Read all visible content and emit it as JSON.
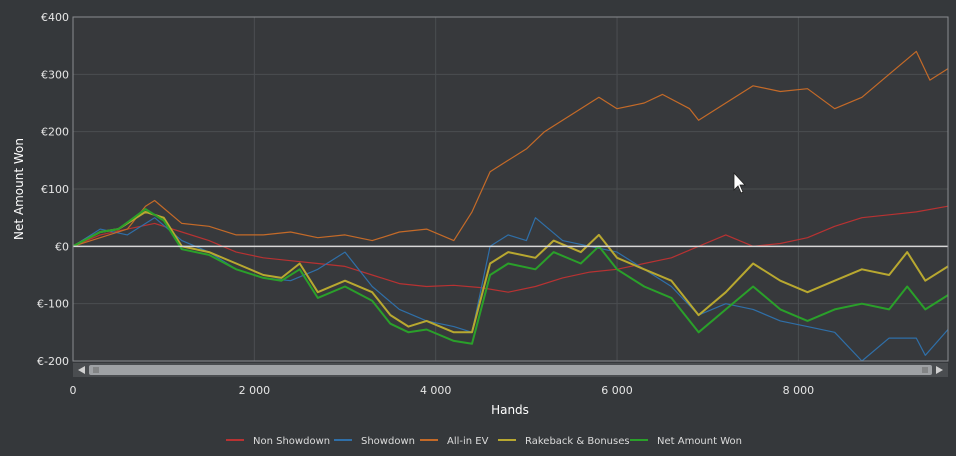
{
  "chart_data": {
    "type": "line",
    "title": "",
    "xlabel": "Hands",
    "ylabel": "Net Amount Won",
    "xlim": [
      0,
      9650
    ],
    "ylim": [
      -200,
      400
    ],
    "x_ticks": [
      0,
      2000,
      4000,
      6000,
      8000
    ],
    "x_tick_labels": [
      "0",
      "2 000",
      "4 000",
      "6 000",
      "8 000"
    ],
    "y_ticks": [
      -200,
      -100,
      0,
      100,
      200,
      300,
      400
    ],
    "y_tick_labels": [
      "€-200",
      "€-100",
      "€0",
      "€100",
      "€200",
      "€300",
      "€400"
    ],
    "grid": true,
    "legend_position": "bottom",
    "series": [
      {
        "name": "Non Showdown",
        "color": "#b83232",
        "points": [
          [
            0,
            0
          ],
          [
            300,
            20
          ],
          [
            600,
            30
          ],
          [
            900,
            40
          ],
          [
            1200,
            25
          ],
          [
            1500,
            10
          ],
          [
            1800,
            -10
          ],
          [
            2100,
            -20
          ],
          [
            2400,
            -25
          ],
          [
            2700,
            -30
          ],
          [
            3000,
            -35
          ],
          [
            3300,
            -50
          ],
          [
            3600,
            -65
          ],
          [
            3900,
            -70
          ],
          [
            4200,
            -68
          ],
          [
            4500,
            -72
          ],
          [
            4800,
            -80
          ],
          [
            5100,
            -70
          ],
          [
            5400,
            -55
          ],
          [
            5700,
            -45
          ],
          [
            6000,
            -40
          ],
          [
            6300,
            -30
          ],
          [
            6600,
            -20
          ],
          [
            6900,
            0
          ],
          [
            7200,
            20
          ],
          [
            7500,
            0
          ],
          [
            7800,
            5
          ],
          [
            8100,
            15
          ],
          [
            8400,
            35
          ],
          [
            8700,
            50
          ],
          [
            9000,
            55
          ],
          [
            9300,
            60
          ],
          [
            9650,
            70
          ]
        ]
      },
      {
        "name": "Showdown",
        "color": "#2f6fa8",
        "points": [
          [
            0,
            0
          ],
          [
            300,
            30
          ],
          [
            600,
            20
          ],
          [
            900,
            50
          ],
          [
            1200,
            10
          ],
          [
            1500,
            -10
          ],
          [
            1800,
            -40
          ],
          [
            2100,
            -55
          ],
          [
            2400,
            -60
          ],
          [
            2700,
            -40
          ],
          [
            3000,
            -10
          ],
          [
            3300,
            -70
          ],
          [
            3600,
            -110
          ],
          [
            3900,
            -130
          ],
          [
            4200,
            -140
          ],
          [
            4400,
            -150
          ],
          [
            4600,
            0
          ],
          [
            4800,
            20
          ],
          [
            5000,
            10
          ],
          [
            5100,
            50
          ],
          [
            5400,
            10
          ],
          [
            5700,
            0
          ],
          [
            6000,
            -10
          ],
          [
            6300,
            -40
          ],
          [
            6600,
            -70
          ],
          [
            6900,
            -120
          ],
          [
            7200,
            -100
          ],
          [
            7500,
            -110
          ],
          [
            7800,
            -130
          ],
          [
            8100,
            -140
          ],
          [
            8400,
            -150
          ],
          [
            8700,
            -200
          ],
          [
            9000,
            -160
          ],
          [
            9300,
            -160
          ],
          [
            9400,
            -190
          ],
          [
            9650,
            -145
          ]
        ]
      },
      {
        "name": "All-in EV",
        "color": "#c46a28",
        "points": [
          [
            0,
            0
          ],
          [
            300,
            15
          ],
          [
            600,
            30
          ],
          [
            800,
            70
          ],
          [
            900,
            80
          ],
          [
            1200,
            40
          ],
          [
            1500,
            35
          ],
          [
            1800,
            20
          ],
          [
            2100,
            20
          ],
          [
            2400,
            25
          ],
          [
            2700,
            15
          ],
          [
            3000,
            20
          ],
          [
            3300,
            10
          ],
          [
            3600,
            25
          ],
          [
            3900,
            30
          ],
          [
            4200,
            10
          ],
          [
            4400,
            60
          ],
          [
            4600,
            130
          ],
          [
            4800,
            150
          ],
          [
            5000,
            170
          ],
          [
            5200,
            200
          ],
          [
            5500,
            230
          ],
          [
            5800,
            260
          ],
          [
            6000,
            240
          ],
          [
            6300,
            250
          ],
          [
            6500,
            265
          ],
          [
            6800,
            240
          ],
          [
            6900,
            220
          ],
          [
            7200,
            250
          ],
          [
            7500,
            280
          ],
          [
            7800,
            270
          ],
          [
            8100,
            275
          ],
          [
            8400,
            240
          ],
          [
            8700,
            260
          ],
          [
            9000,
            300
          ],
          [
            9300,
            340
          ],
          [
            9450,
            290
          ],
          [
            9650,
            310
          ]
        ]
      },
      {
        "name": "Rakeback & Bonuses",
        "color": "#b8a830",
        "points": [
          [
            0,
            0
          ],
          [
            300,
            25
          ],
          [
            500,
            30
          ],
          [
            800,
            60
          ],
          [
            1000,
            50
          ],
          [
            1200,
            0
          ],
          [
            1500,
            -10
          ],
          [
            1800,
            -30
          ],
          [
            2100,
            -50
          ],
          [
            2300,
            -55
          ],
          [
            2500,
            -30
          ],
          [
            2700,
            -80
          ],
          [
            3000,
            -60
          ],
          [
            3300,
            -80
          ],
          [
            3500,
            -120
          ],
          [
            3700,
            -140
          ],
          [
            3900,
            -130
          ],
          [
            4200,
            -150
          ],
          [
            4400,
            -150
          ],
          [
            4600,
            -30
          ],
          [
            4800,
            -10
          ],
          [
            5100,
            -20
          ],
          [
            5300,
            10
          ],
          [
            5600,
            -10
          ],
          [
            5800,
            20
          ],
          [
            6000,
            -20
          ],
          [
            6300,
            -40
          ],
          [
            6600,
            -60
          ],
          [
            6900,
            -120
          ],
          [
            7200,
            -80
          ],
          [
            7500,
            -30
          ],
          [
            7800,
            -60
          ],
          [
            8100,
            -80
          ],
          [
            8400,
            -60
          ],
          [
            8700,
            -40
          ],
          [
            9000,
            -50
          ],
          [
            9200,
            -10
          ],
          [
            9400,
            -60
          ],
          [
            9650,
            -35
          ]
        ]
      },
      {
        "name": "Net Amount Won",
        "color": "#2aa02a",
        "points": [
          [
            0,
            0
          ],
          [
            300,
            25
          ],
          [
            500,
            30
          ],
          [
            800,
            65
          ],
          [
            1000,
            45
          ],
          [
            1200,
            -5
          ],
          [
            1500,
            -15
          ],
          [
            1800,
            -40
          ],
          [
            2100,
            -55
          ],
          [
            2300,
            -60
          ],
          [
            2500,
            -40
          ],
          [
            2700,
            -90
          ],
          [
            3000,
            -70
          ],
          [
            3300,
            -95
          ],
          [
            3500,
            -135
          ],
          [
            3700,
            -150
          ],
          [
            3900,
            -145
          ],
          [
            4200,
            -165
          ],
          [
            4400,
            -170
          ],
          [
            4600,
            -50
          ],
          [
            4800,
            -30
          ],
          [
            5100,
            -40
          ],
          [
            5300,
            -10
          ],
          [
            5600,
            -30
          ],
          [
            5800,
            0
          ],
          [
            6000,
            -40
          ],
          [
            6300,
            -70
          ],
          [
            6600,
            -90
          ],
          [
            6900,
            -150
          ],
          [
            7200,
            -110
          ],
          [
            7500,
            -70
          ],
          [
            7800,
            -110
          ],
          [
            8100,
            -130
          ],
          [
            8400,
            -110
          ],
          [
            8700,
            -100
          ],
          [
            9000,
            -110
          ],
          [
            9200,
            -70
          ],
          [
            9400,
            -110
          ],
          [
            9650,
            -85
          ]
        ]
      }
    ]
  }
}
